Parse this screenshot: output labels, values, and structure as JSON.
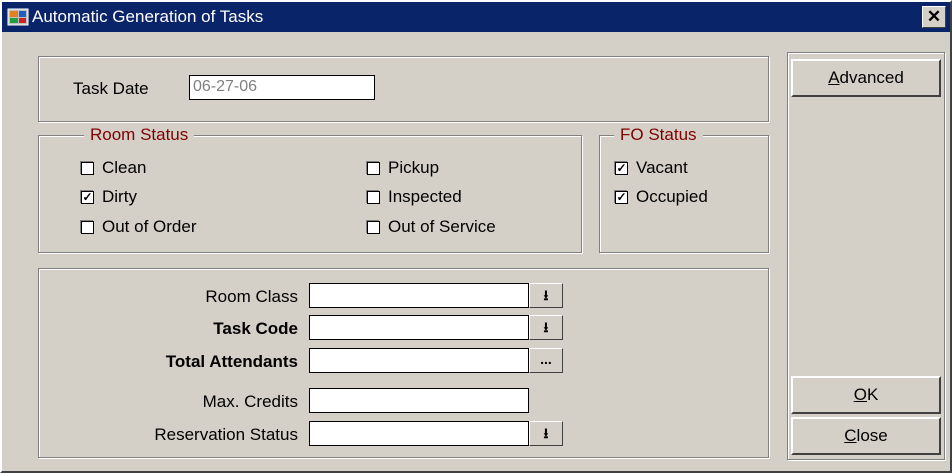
{
  "window": {
    "title": "Automatic Generation of Tasks",
    "close_glyph": "✕"
  },
  "task_date": {
    "label": "Task Date",
    "value": "06-27-06"
  },
  "room_status": {
    "legend": "Room Status",
    "items": [
      {
        "label": "Clean",
        "checked": false
      },
      {
        "label": "Dirty",
        "checked": true
      },
      {
        "label": "Out of Order",
        "checked": false
      },
      {
        "label": "Pickup",
        "checked": false
      },
      {
        "label": "Inspected",
        "checked": false
      },
      {
        "label": "Out of Service",
        "checked": false
      }
    ]
  },
  "fo_status": {
    "legend": "FO Status",
    "items": [
      {
        "label": "Vacant",
        "checked": true
      },
      {
        "label": "Occupied",
        "checked": true
      }
    ]
  },
  "fields": {
    "room_class": {
      "label": "Room Class",
      "value": ""
    },
    "task_code": {
      "label": "Task Code",
      "value": ""
    },
    "total_attendants": {
      "label": "Total Attendants",
      "value": "",
      "button": "..."
    },
    "max_credits": {
      "label": "Max. Credits",
      "value": ""
    },
    "reservation_status": {
      "label": "Reservation Status",
      "value": ""
    }
  },
  "buttons": {
    "advanced": {
      "mnemonic": "A",
      "rest": "dvanced"
    },
    "ok": {
      "mnemonic": "O",
      "rest": "K"
    },
    "close": {
      "mnemonic": "C",
      "rest": "lose"
    }
  },
  "dropdown_glyph": "⭳",
  "check_glyph": "✓",
  "colors": {
    "titlebar": "#0a246a",
    "legend_text": "#800000",
    "face": "#d4d0c8"
  }
}
